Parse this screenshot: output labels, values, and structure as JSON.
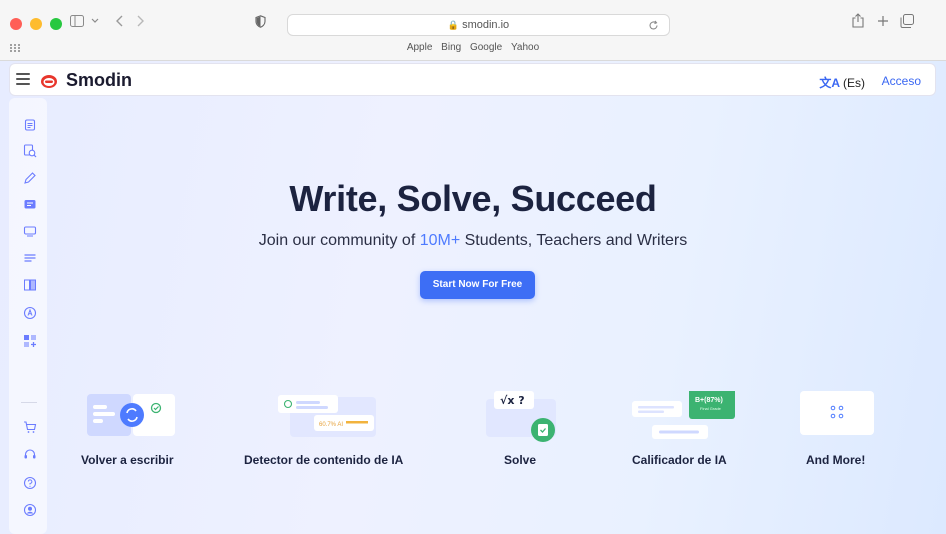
{
  "browser": {
    "url": "smodin.io",
    "bookmarks": [
      "Apple",
      "Bing",
      "Google",
      "Yahoo"
    ]
  },
  "header": {
    "brand": "Smodin",
    "language": "(Es)",
    "login": "Acceso"
  },
  "sidebar": {
    "items": [
      "rewriter-icon",
      "plagiarism-icon",
      "writer-icon",
      "chat-icon",
      "grader-icon",
      "summarizer-icon",
      "research-icon",
      "ai-detector-icon",
      "more-apps-icon"
    ],
    "bottom_items": [
      "cart-icon",
      "support-icon",
      "help-icon",
      "account-icon"
    ]
  },
  "hero": {
    "title": "Write, Solve, Succeed",
    "subtitle_before": "Join our community of ",
    "subtitle_highlight": "10M+",
    "subtitle_after": " Students, Teachers and Writers",
    "cta": "Start Now For Free"
  },
  "features": [
    {
      "label": "Volver a escribir"
    },
    {
      "label": "Detector de contenido de IA",
      "badge": "60.7% AI"
    },
    {
      "label": "Solve",
      "math": "√x ?"
    },
    {
      "label": "Calificador de IA",
      "grade": "B+(87%)",
      "grade_sub": "Final Grade"
    },
    {
      "label": "And More!"
    }
  ],
  "colors": {
    "accent": "#3d6ef5",
    "brand_red": "#e8362c",
    "green": "#3cb371"
  }
}
